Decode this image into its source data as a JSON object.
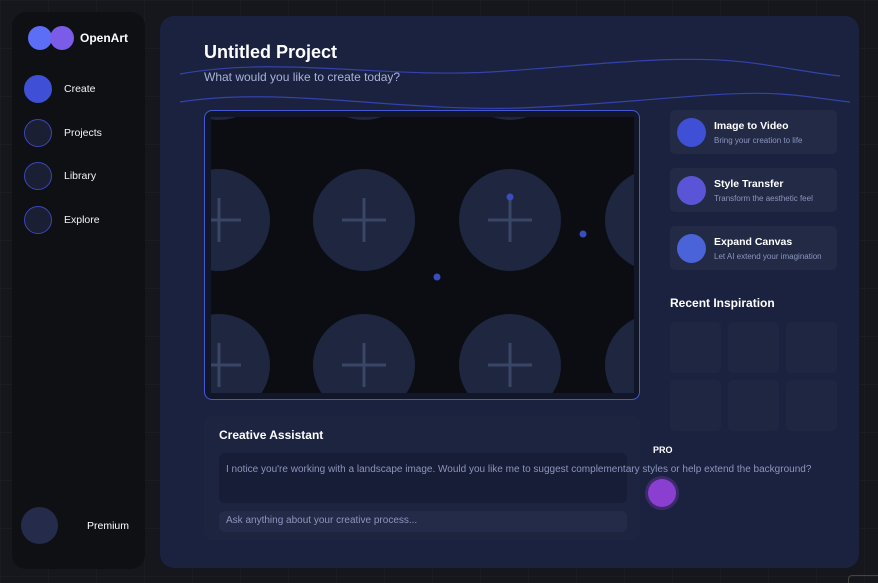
{
  "app": {
    "name": "OpenArt"
  },
  "sidebar": {
    "items": [
      {
        "label": "Create",
        "active": true
      },
      {
        "label": "Projects",
        "active": false
      },
      {
        "label": "Library",
        "active": false
      },
      {
        "label": "Explore",
        "active": false
      }
    ],
    "premium_label": "Premium"
  },
  "project": {
    "title": "Untitled Project",
    "subtitle": "What would you like to create today?"
  },
  "features": [
    {
      "title": "Image to Video",
      "description": "Bring your creation to life",
      "color": "#3f50d6"
    },
    {
      "title": "Style Transfer",
      "description": "Transform the aesthetic feel",
      "color": "#5a55d6"
    },
    {
      "title": "Expand Canvas",
      "description": "Let AI extend your imagination",
      "color": "#4a63d8"
    }
  ],
  "recent": {
    "title": "Recent Inspiration"
  },
  "assistant": {
    "title": "Creative Assistant",
    "message": "I notice you're working with a landscape image. Would you like me to suggest complementary styles or help extend the background?",
    "input_placeholder": "Ask anything about your creative process..."
  },
  "pro_badge": "PRO",
  "colors": {
    "accent": "#3f50d6",
    "accent_purple": "#7b5ce8",
    "pro": "#8a3fd1"
  }
}
